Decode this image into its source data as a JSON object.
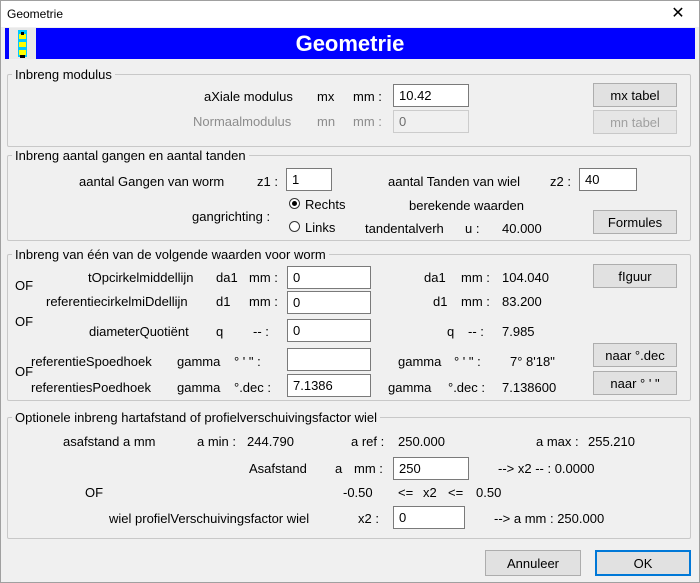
{
  "window": {
    "title": "Geometrie",
    "close_glyph": "✕"
  },
  "banner": {
    "title": "Geometrie"
  },
  "modulus": {
    "legend": "Inbreng modulus",
    "axial_label": "aXiale modulus",
    "axial_sym": "mx",
    "axial_unit": "mm :",
    "axial_value": "10.42",
    "normal_label": "Normaalmodulus",
    "normal_sym": "mn",
    "normal_unit": "mm :",
    "normal_value": "0",
    "mx_button": "mx tabel",
    "mn_button": "mn tabel"
  },
  "gangen": {
    "legend": "Inbreng aantal gangen en aantal tanden",
    "z1_label": "aantal Gangen van worm",
    "z1_sym": "z1 :",
    "z1_value": "1",
    "z2_label": "aantal Tanden van wiel",
    "z2_sym": "z2 :",
    "z2_value": "40",
    "direction_label": "gangrichting :",
    "radio_right": "Rechts",
    "radio_left": "Links",
    "computed_header": "berekende waarden",
    "ratio_label": "tandentalverh",
    "ratio_sym": "u :",
    "ratio_value": "40.000",
    "formules_button": "Formules"
  },
  "worm": {
    "legend": "Inbreng van één van de volgende waarden voor worm",
    "of": "OF",
    "da1_label": "tOpcirkelmiddellijn",
    "da1_sym": "da1",
    "da1_unit": "mm :",
    "da1_value": "0",
    "da1_res_sym": "da1",
    "da1_res_unit": "mm :",
    "da1_res_value": "104.040",
    "figuur_button": "fIguur",
    "d1_label": "referentiecirkelmiDdellijn",
    "d1_sym": "d1",
    "d1_unit": "mm :",
    "d1_value": "0",
    "d1_res_sym": "d1",
    "d1_res_unit": "mm :",
    "d1_res_value": "83.200",
    "q_label": "diameterQuotiënt",
    "q_sym": "q",
    "q_unit": "-- :",
    "q_value": "0",
    "q_res_sym": "q",
    "q_res_unit": "-- :",
    "q_res_value": "7.985",
    "gamma_dms_label": "referentieSpoedhoek",
    "gamma_dms_sym": "gamma",
    "gamma_dms_unit": "° ' \" :",
    "gamma_dms_value": "",
    "gamma_dms_res_sym": "gamma",
    "gamma_dms_res_unit": "° ' \" :",
    "gamma_dms_res_value": "7° 8'18\"",
    "naar_dec_button": "naar °.dec",
    "gamma_dec_label": "referentiesPoedhoek",
    "gamma_dec_sym": "gamma",
    "gamma_dec_unit": "°.dec :",
    "gamma_dec_value": "7.1386",
    "gamma_dec_res_sym": "gamma",
    "gamma_dec_res_unit": "°.dec :",
    "gamma_dec_res_value": "7.138600",
    "naar_dms_button": "naar ° ' \""
  },
  "hart": {
    "legend": "Optionele inbreng hartafstand of profielverschuivingsfactor wiel",
    "asafstand_label": "asafstand  a  mm",
    "amin_label": "a min :",
    "amin_value": "244.790",
    "aref_label": "a ref :",
    "aref_value": "250.000",
    "amax_label": "a max :",
    "amax_value": "255.210",
    "a_input_label": "Asafstand",
    "a_input_sym": "a",
    "a_input_unit": "mm :",
    "a_value": "250",
    "a_result": "--> x2  -- :  0.0000",
    "of": "OF",
    "range_low": "-0.50",
    "range_mid1": "<=",
    "range_var": "x2",
    "range_mid2": "<=",
    "range_high": "0.50",
    "x2_label": "wiel profielVerschuivingsfactor wiel",
    "x2_sym": "x2 :",
    "x2_value": "0",
    "x2_result": "--> a    mm :  250.000"
  },
  "footer": {
    "cancel_button": "Annuleer",
    "ok_button": "OK"
  }
}
